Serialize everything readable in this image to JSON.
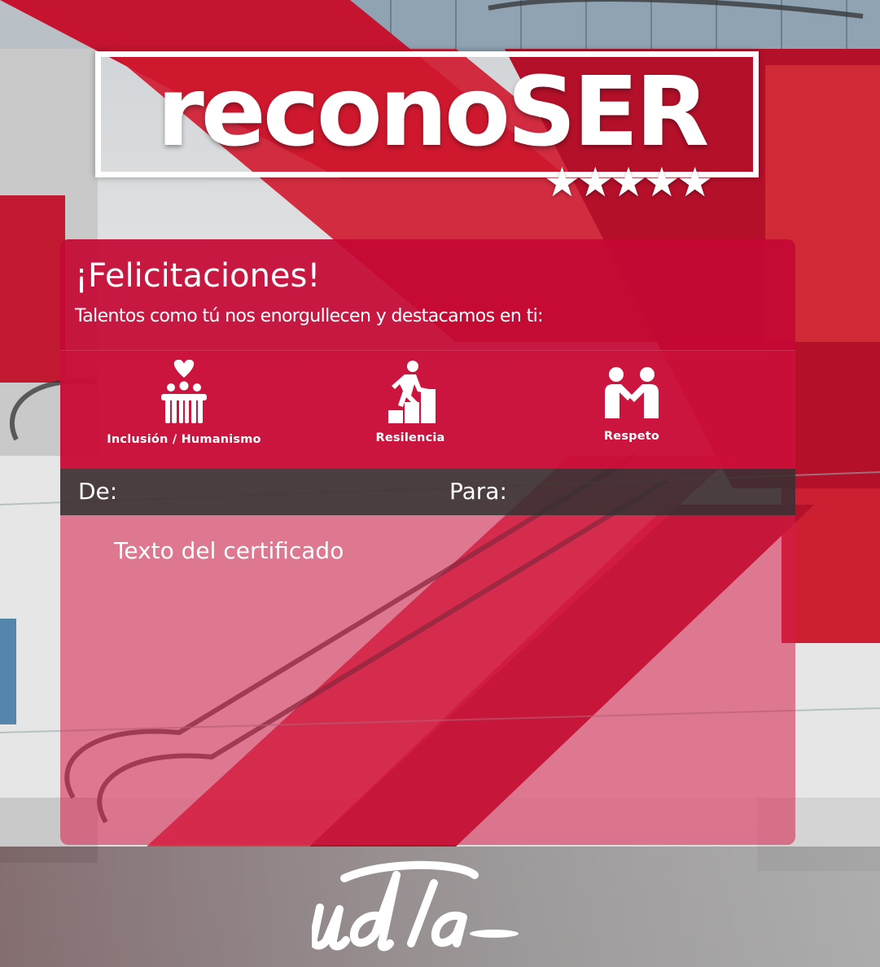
{
  "logo": {
    "wordmark": "reconoSER",
    "stars": "★★★★★",
    "star_count": 5
  },
  "card": {
    "title": "¡Felicitaciones!",
    "subtitle": "Talentos como tú nos enorgullecen y destacamos en ti:",
    "values": [
      {
        "icon": "group-heart-icon",
        "label": "Inclusión / Humanismo"
      },
      {
        "icon": "climbing-steps-icon",
        "label": "Resilencia"
      },
      {
        "icon": "handshake-icon",
        "label": "Respeto"
      }
    ],
    "from_label": "De:",
    "to_label": "Para:",
    "body_text": "Texto del certificado"
  },
  "footer": {
    "brand_logo": "udla"
  },
  "colors": {
    "accent_red": "#c40934",
    "dark_band": "#3e3033",
    "text": "#ffffff"
  }
}
